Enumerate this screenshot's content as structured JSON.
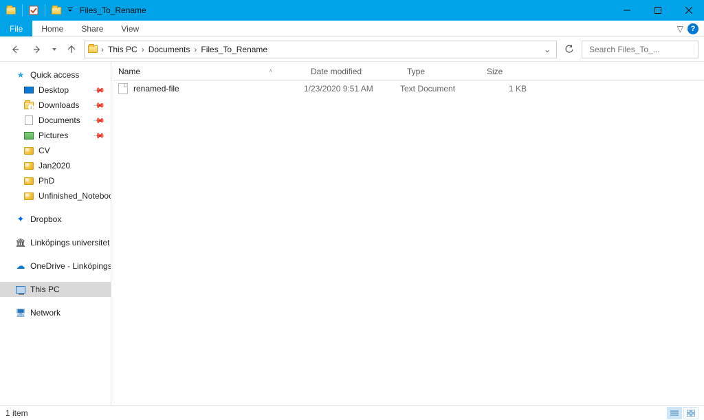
{
  "titlebar": {
    "title": "Files_To_Rename"
  },
  "ribbon": {
    "file": "File",
    "tabs": [
      "Home",
      "Share",
      "View"
    ]
  },
  "breadcrumbs": {
    "segments": [
      "This PC",
      "Documents",
      "Files_To_Rename"
    ]
  },
  "search": {
    "placeholder": "Search Files_To_..."
  },
  "sidebar": {
    "quick_access": "Quick access",
    "desktop": "Desktop",
    "downloads": "Downloads",
    "documents": "Documents",
    "pictures": "Pictures",
    "cv": "CV",
    "jan2020": "Jan2020",
    "phd": "PhD",
    "unfinished": "Unfinished_Notebooks",
    "dropbox": "Dropbox",
    "linkoping": "Linköpings universitet",
    "onedrive": "OneDrive - Linköpings",
    "thispc": "This PC",
    "network": "Network"
  },
  "columns": {
    "name": "Name",
    "date": "Date modified",
    "type": "Type",
    "size": "Size"
  },
  "files": [
    {
      "name": "renamed-file",
      "date": "1/23/2020 9:51 AM",
      "type": "Text Document",
      "size": "1 KB"
    }
  ],
  "status": {
    "left": "1 item"
  }
}
